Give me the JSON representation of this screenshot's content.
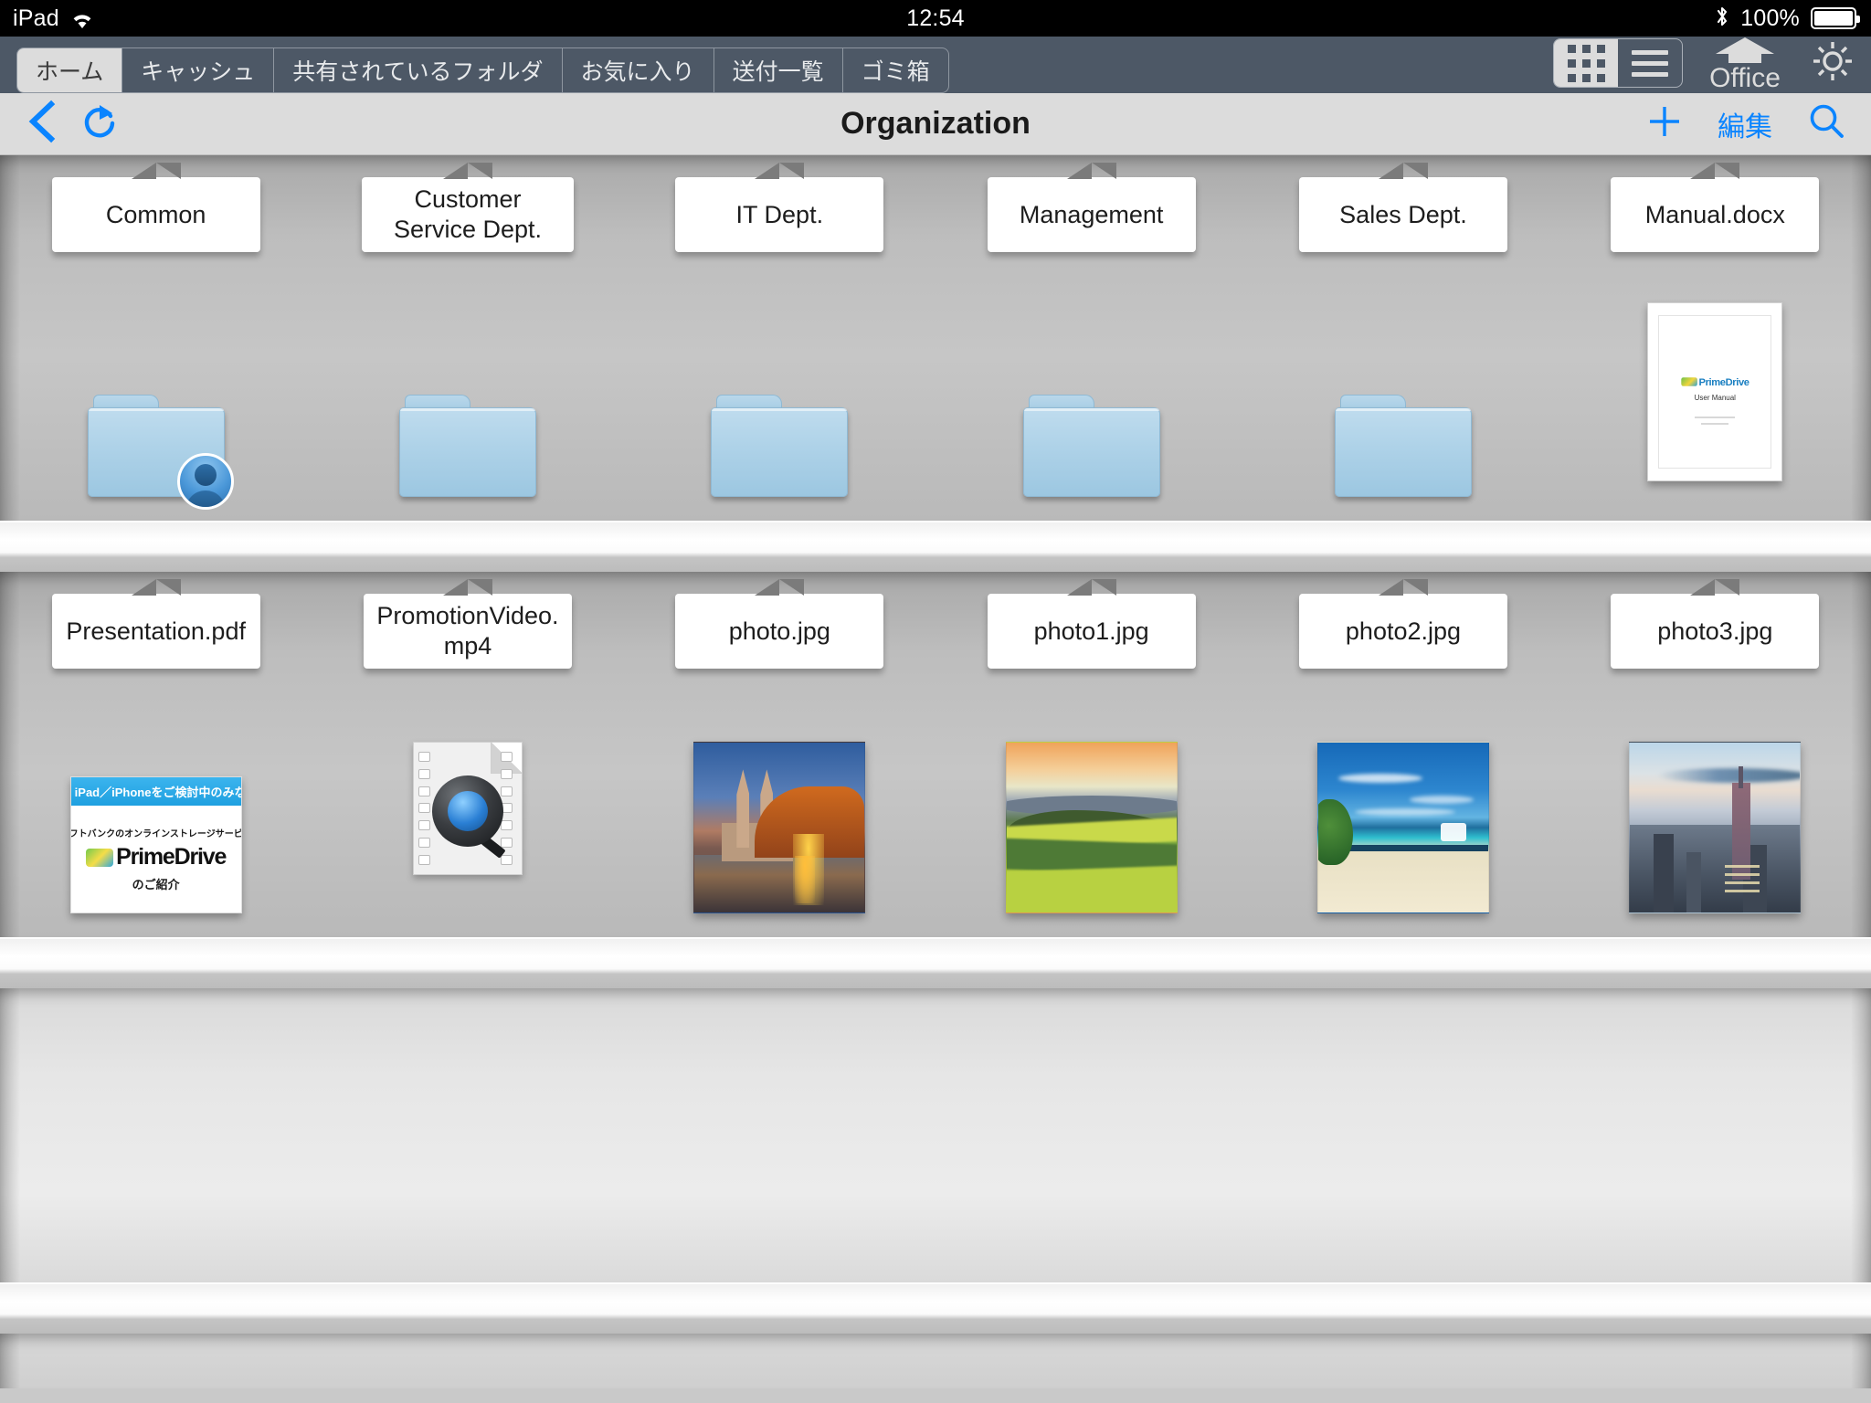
{
  "statusbar": {
    "device": "iPad",
    "wifi_icon": "wifi-icon",
    "time": "12:54",
    "bluetooth_icon": "bluetooth-icon",
    "battery_percent": "100%",
    "battery_icon": "battery-full-icon"
  },
  "toolbar": {
    "tabs": [
      {
        "label": "ホーム",
        "active": true
      },
      {
        "label": "キャッシュ",
        "active": false
      },
      {
        "label": "共有されているフォルダ",
        "active": false
      },
      {
        "label": "お気に入り",
        "active": false
      },
      {
        "label": "送付一覧",
        "active": false
      },
      {
        "label": "ゴミ箱",
        "active": false
      }
    ],
    "view_grid_icon": "grid-view-icon",
    "view_list_icon": "list-view-icon",
    "office_label": "Office",
    "office_icon": "office-upload-icon",
    "settings_icon": "gear-icon",
    "bar_color": "#4d5866",
    "active_tab_color": "#dcdcdc"
  },
  "navbar": {
    "back_icon": "chevron-left-icon",
    "refresh_icon": "refresh-icon",
    "title": "Organization",
    "add_icon": "plus-icon",
    "edit_label": "編集",
    "search_icon": "search-icon",
    "accent_color": "#0a84ff"
  },
  "shelves": [
    {
      "items": [
        {
          "name": "Common",
          "kind": "folder",
          "badge": "user-badge"
        },
        {
          "name": "Customer\nService Dept.",
          "kind": "folder",
          "badge": null
        },
        {
          "name": "IT Dept.",
          "kind": "folder",
          "badge": null
        },
        {
          "name": "Management",
          "kind": "folder",
          "badge": null
        },
        {
          "name": "Sales Dept.",
          "kind": "folder",
          "badge": null
        },
        {
          "name": "Manual.docx",
          "kind": "document",
          "badge": null
        }
      ]
    },
    {
      "items": [
        {
          "name": "Presentation.pdf",
          "kind": "pdf",
          "badge": null
        },
        {
          "name": "PromotionVideo.\nmp4",
          "kind": "video",
          "badge": null
        },
        {
          "name": "photo.jpg",
          "kind": "photo",
          "badge": null
        },
        {
          "name": "photo1.jpg",
          "kind": "photo",
          "badge": null
        },
        {
          "name": "photo2.jpg",
          "kind": "photo",
          "badge": null
        },
        {
          "name": "photo3.jpg",
          "kind": "photo",
          "badge": null
        }
      ]
    },
    {
      "items": []
    }
  ],
  "thumbnails": {
    "manual_docx": {
      "brand": "PrimeDrive",
      "subtitle": "User Manual"
    },
    "presentation_pdf": {
      "banner": "iPad／iPhoneをご検討中のみなさまへ",
      "line1": "ソフトバンクのオンラインストレージサービス",
      "brand": "PrimeDrive",
      "line2": "のご紹介"
    },
    "promotion_video": {
      "icon": "quicktime-movie-icon"
    },
    "photo_jpg": {
      "scene": "cathedral and bridge at dusk"
    },
    "photo1_jpg": {
      "scene": "green rolling hills at sunset"
    },
    "photo2_jpg": {
      "scene": "tropical beach with turquoise sea"
    },
    "photo3_jpg": {
      "scene": "city skyline at dusk"
    }
  }
}
